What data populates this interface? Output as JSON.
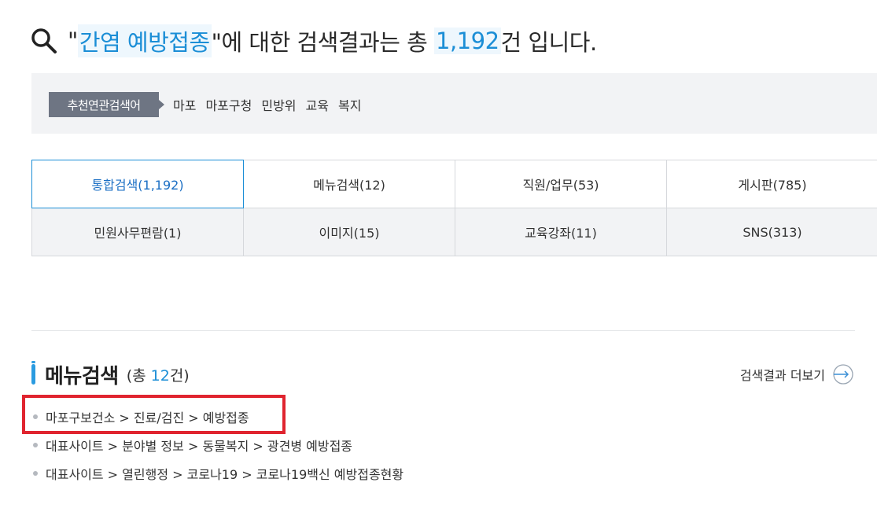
{
  "headline": {
    "open_quote": "\"",
    "keyword": "간염 예방접종",
    "mid": "\"에 대한 검색결과는 총 ",
    "count": "1,192",
    "tail": "건 입니다."
  },
  "related": {
    "label": "추천연관검색어",
    "terms": [
      "마포",
      "마포구청",
      "민방위",
      "교육",
      "복지"
    ]
  },
  "tabs": [
    [
      "통합검색(1,192)",
      "메뉴검색(12)",
      "직원/업무(53)",
      "게시판(785)"
    ],
    [
      "민원사무편람(1)",
      "이미지(15)",
      "교육강좌(11)",
      "SNS(313)"
    ]
  ],
  "menu_section": {
    "title": "메뉴검색",
    "sub_open": "(총 ",
    "sub_count": "12",
    "sub_close": "건)",
    "more": "검색결과 더보기",
    "items": [
      "마포구보건소 > 진료/검진 > 예방접종",
      "대표사이트 > 분야별 정보 > 동물복지 > 광견병 예방접종",
      "대표사이트 > 열린행정 > 코로나19 > 코로나19백신 예방접종현황"
    ]
  },
  "colors": {
    "accent": "#1b8ed6",
    "highlight": "#e0242f",
    "tag_bg": "#6e7583"
  }
}
